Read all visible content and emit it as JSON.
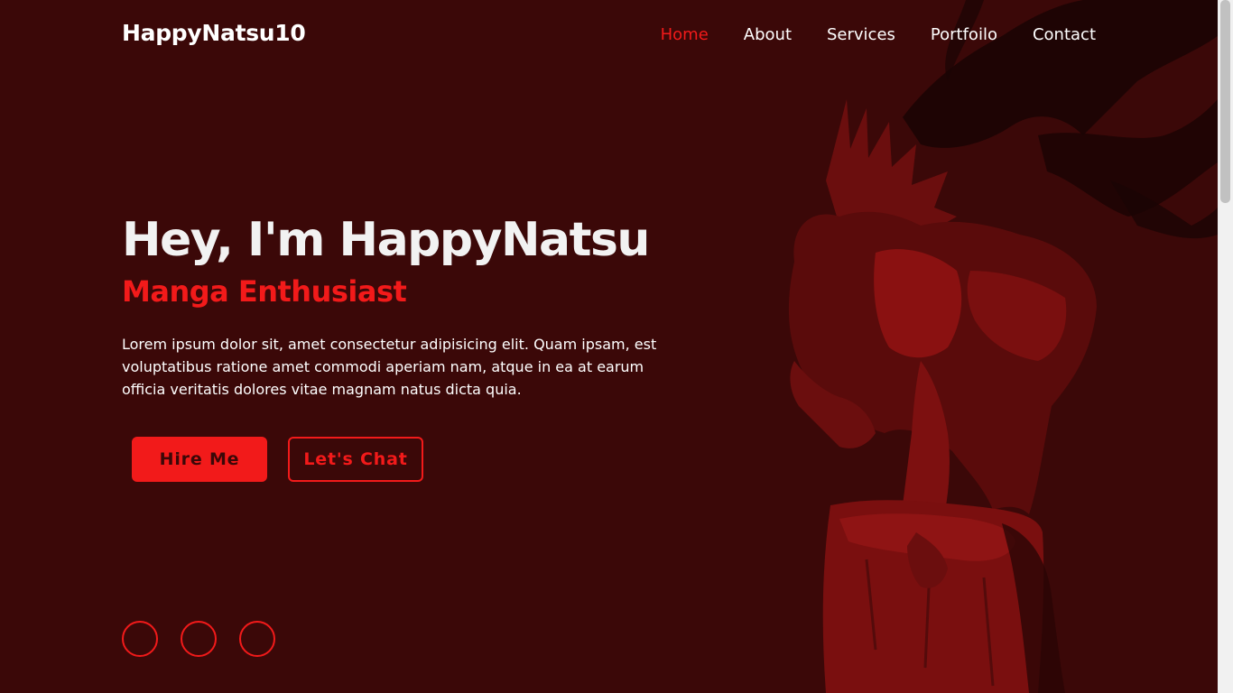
{
  "header": {
    "logo": "HappyNatsu10",
    "nav": [
      {
        "label": "Home",
        "active": true
      },
      {
        "label": "About",
        "active": false
      },
      {
        "label": "Services",
        "active": false
      },
      {
        "label": "Portfoilo",
        "active": false
      },
      {
        "label": "Contact",
        "active": false
      }
    ]
  },
  "hero": {
    "title": "Hey, I'm HappyNatsu",
    "subtitle": "Manga Enthusiast",
    "text": "Lorem ipsum dolor sit, amet consectetur adipisicing elit. Quam ipsam, est voluptatibus ratione amet commodi aperiam nam, atque in ea at earum officia veritatis dolores vitae magnam natus dicta quia.",
    "buttons": {
      "hire": "Hire Me",
      "chat": "Let's Chat"
    },
    "social_icons": [
      "social-icon-1",
      "social-icon-2",
      "social-icon-3"
    ]
  },
  "colors": {
    "background": "#3b0808",
    "accent": "#f21a1a",
    "text": "#ffffff"
  }
}
